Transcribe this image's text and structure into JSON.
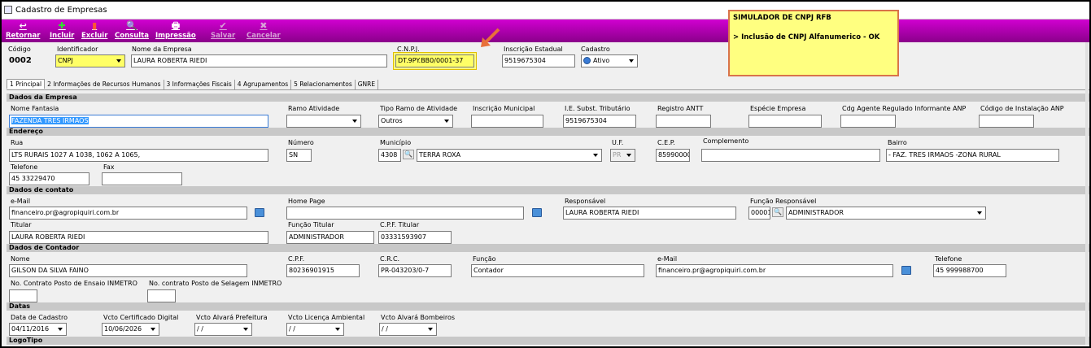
{
  "window": {
    "title": "Cadastro de Empresas"
  },
  "toolbar": {
    "items": [
      {
        "label": "Retornar",
        "icon": "↩"
      },
      {
        "label": "Incluir",
        "icon": "✚"
      },
      {
        "label": "Excluir",
        "icon": "▮"
      },
      {
        "label": "Consulta",
        "icon": "🔍"
      },
      {
        "label": "Impressão",
        "icon": "🖶"
      },
      {
        "label": "Salvar",
        "icon": "✔"
      },
      {
        "label": "Cancelar",
        "icon": "✖"
      }
    ]
  },
  "popup": {
    "line1": "SIMULADOR DE CNPJ RFB",
    "line2": "> Inclusão de CNPJ Alfanumerico - OK"
  },
  "header": {
    "codigo_label": "Código",
    "codigo_value": "0002",
    "identificador_label": "Identificador",
    "identificador_value": "CNPJ",
    "nome_label": "Nome da Empresa",
    "nome_value": "LAURA ROBERTA RIEDI",
    "cnpj_label": "C.N.P.J.",
    "cnpj_value": "DT.9PY.BB0/0001-37",
    "ie_label": "Inscrição Estadual",
    "ie_value": "9519675304",
    "cadastro_label": "Cadastro",
    "cadastro_value": "Ativo"
  },
  "tabs": [
    {
      "label": "1 Principal"
    },
    {
      "label": "2 Informações de Recursos Humanos"
    },
    {
      "label": "3 Informações Fiscais"
    },
    {
      "label": "4 Agrupamentos"
    },
    {
      "label": "5 Relacionamentos"
    },
    {
      "label": "GNRE"
    }
  ],
  "dados_empresa": {
    "section": "Dados da Empresa",
    "nome_fantasia_label": "Nome Fantasia",
    "nome_fantasia_value": "FAZENDA TRES IRMAOS",
    "ramo_label": "Ramo Atividade",
    "ramo_value": "",
    "tipo_ramo_label": "Tipo Ramo de Atividade",
    "tipo_ramo_value": "Outros",
    "im_label": "Inscrição Municipal",
    "im_value": "",
    "ie_st_label": "I.E. Subst. Tributário",
    "ie_st_value": "9519675304",
    "antt_label": "Registro ANTT",
    "antt_value": "",
    "especie_label": "Espécie Empresa",
    "especie_value": "",
    "cdg_anp_label": "Cdg Agente Regulado Informante ANP",
    "cdg_anp_value": "",
    "cod_inst_label": "Código de Instalação ANP",
    "cod_inst_value": ""
  },
  "endereco": {
    "section": "Endereço",
    "rua_label": "Rua",
    "rua_value": "LTS RURAIS 1027 A 1038, 1062 A 1065,",
    "numero_label": "Número",
    "numero_value": "SN",
    "municipio_label": "Município",
    "municipio_code": "4308",
    "municipio_name": "TERRA ROXA",
    "uf_label": "U.F.",
    "uf_value": "PR",
    "cep_label": "C.E.P.",
    "cep_value": "85990000",
    "complemento_label": "Complemento",
    "complemento_value": "",
    "bairro_label": "Bairro",
    "bairro_value": "- FAZ. TRES IRMAOS -ZONA RURAL",
    "telefone_label": "Telefone",
    "telefone_value": "45 33229470",
    "fax_label": "Fax",
    "fax_value": ""
  },
  "contato": {
    "section": "Dados de contato",
    "email_label": "e-Mail",
    "email_value": "financeiro.pr@agropiquiri.com.br",
    "homepage_label": "Home Page",
    "homepage_value": "",
    "responsavel_label": "Responsável",
    "responsavel_value": "LAURA ROBERTA RIEDI",
    "funcao_resp_label": "Função Responsável",
    "funcao_resp_code": "00001",
    "funcao_resp_name": "ADMINISTRADOR",
    "titular_label": "Titular",
    "titular_value": "LAURA ROBERTA RIEDI",
    "funcao_titular_label": "Função Titular",
    "funcao_titular_value": "ADMINISTRADOR",
    "cpf_titular_label": "C.P.F. Titular",
    "cpf_titular_value": "03331593907"
  },
  "contador": {
    "section": "Dados de Contador",
    "nome_label": "Nome",
    "nome_value": "GILSON DA SILVA FAINO",
    "cpf_label": "C.P.F.",
    "cpf_value": "80236901915",
    "crc_label": "C.R.C.",
    "crc_value": "PR-043203/0-7",
    "funcao_label": "Função",
    "funcao_value": "Contador",
    "email_label": "e-Mail",
    "email_value": "financeiro.pr@agropiquiri.com.br",
    "telefone_label": "Telefone",
    "telefone_value": "45 999988700",
    "ensaio_label": "No. Contrato Posto de Ensaio INMETRO",
    "ensaio_value": "",
    "selagem_label": "No. contrato Posto de Selagem INMETRO",
    "selagem_value": ""
  },
  "datas": {
    "section": "Datas",
    "cadastro_label": "Data de Cadastro",
    "cadastro_value": "04/11/2016",
    "certificado_label": "Vcto Certificado Digital",
    "certificado_value": "10/06/2026",
    "prefeitura_label": "Vcto Alvará Prefeitura",
    "prefeitura_value": " / /",
    "ambiental_label": "Vcto Licença Ambiental",
    "ambiental_value": " / /",
    "bombeiros_label": "Vcto Alvará Bombeiros",
    "bombeiros_value": " / /"
  },
  "logotipo": {
    "section": "LogoTipo"
  }
}
